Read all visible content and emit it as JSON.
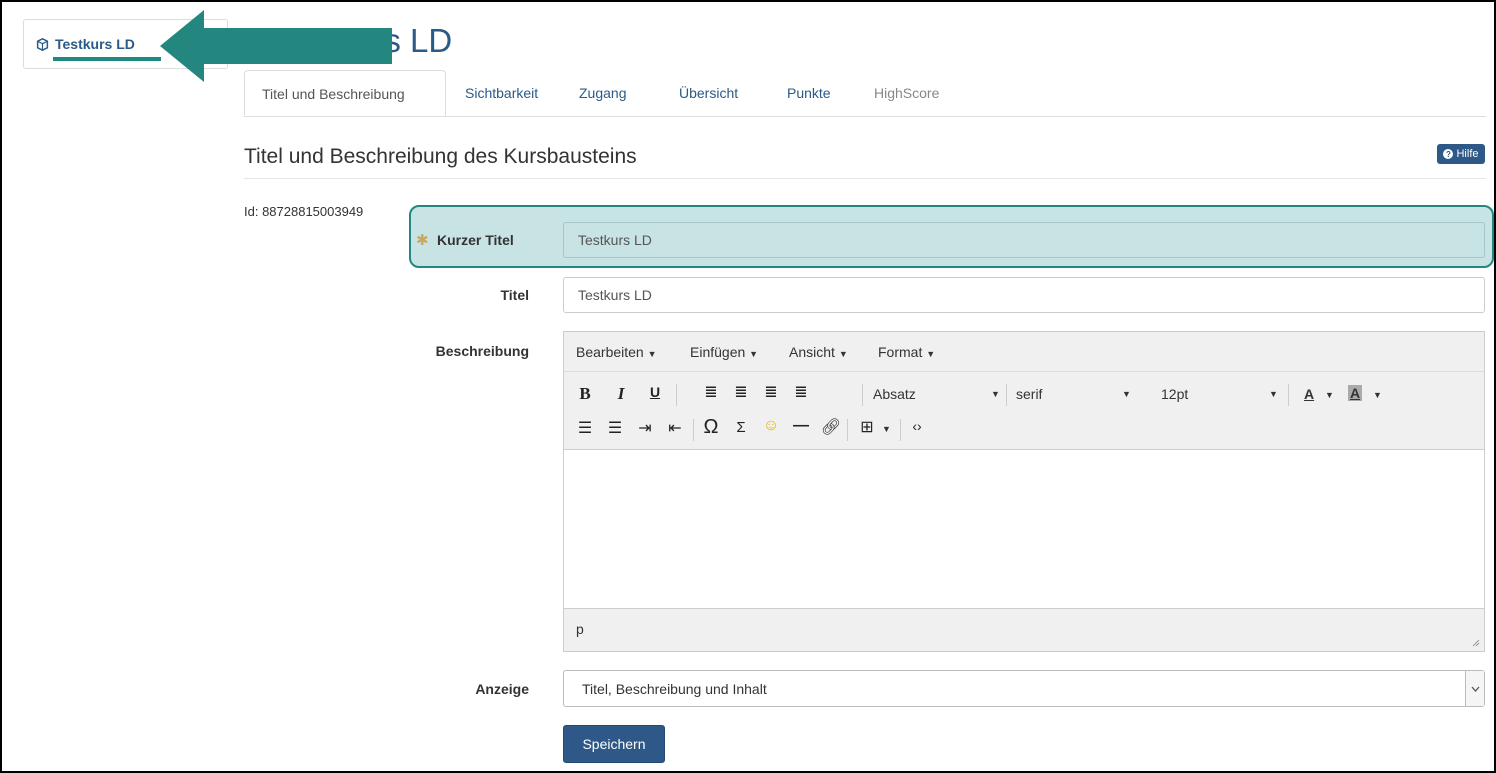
{
  "sidebar": {
    "course_label": "Testkurs LD"
  },
  "page": {
    "title": "Testkurs LD"
  },
  "tabs": [
    {
      "label": "Titel und Beschreibung"
    },
    {
      "label": "Sichtbarkeit"
    },
    {
      "label": "Zugang"
    },
    {
      "label": "Übersicht"
    },
    {
      "label": "Punkte"
    },
    {
      "label": "HighScore"
    }
  ],
  "section": {
    "title": "Titel und Beschreibung des Kursbausteins",
    "help_label": "Hilfe"
  },
  "node_id": "Id: 88728815003949",
  "form": {
    "short_title_label": "Kurzer Titel",
    "short_title_value": "Testkurs LD",
    "title_label": "Titel",
    "title_value": "Testkurs LD",
    "description_label": "Beschreibung",
    "display_label": "Anzeige",
    "display_value": "Titel, Beschreibung und Inhalt",
    "save_label": "Speichern"
  },
  "editor": {
    "menus": [
      "Bearbeiten",
      "Einfügen",
      "Ansicht",
      "Format"
    ],
    "block_format": "Absatz",
    "font_family": "serif",
    "font_size": "12pt",
    "text_color_label": "A",
    "bg_color_label": "A",
    "status_path": "p",
    "icons": [
      "bold-icon",
      "italic-icon",
      "underline-icon",
      "align-justify-icon",
      "align-right-icon",
      "align-center-icon",
      "align-left-icon",
      "bullet-list-icon",
      "numbered-list-icon",
      "indent-icon",
      "outdent-icon",
      "omega-icon",
      "sigma-icon",
      "emoji-icon",
      "horizontal-rule-icon",
      "link-icon",
      "table-icon",
      "code-icon"
    ]
  },
  "colors": {
    "accent": "#2d5887",
    "highlight": "#c7e3e4",
    "arrow": "#23877f"
  }
}
